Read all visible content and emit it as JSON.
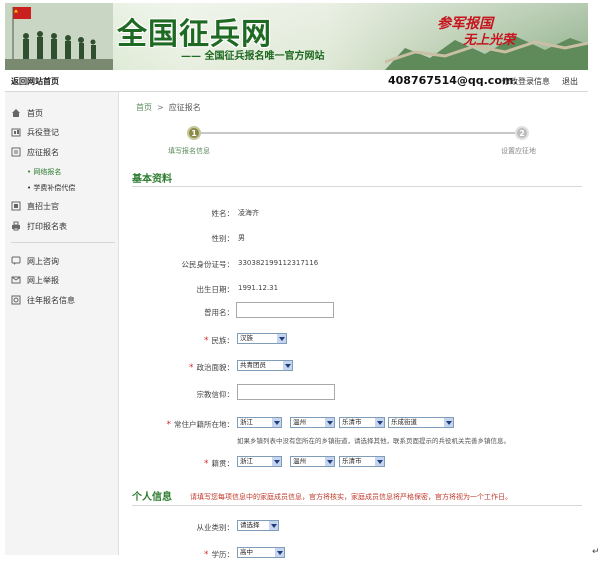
{
  "banner": {
    "brand": "全国征兵网",
    "slogan": "—— 全国征兵报名唯一官方网站",
    "motto_line1": "参军报国",
    "motto_line2": "无上光荣"
  },
  "topbar": {
    "home": "返回网站首页",
    "email": "408767514@qq.com.",
    "edit_info": "修改登录信息",
    "logout": "退出"
  },
  "sidebar": {
    "items": [
      {
        "label": "首页",
        "icon": "home-icon"
      },
      {
        "label": "兵役登记",
        "icon": "register-icon"
      },
      {
        "label": "应征报名",
        "icon": "apply-icon"
      },
      {
        "label": "直招士官",
        "icon": "sergeant-icon"
      },
      {
        "label": "打印报名表",
        "icon": "print-icon"
      },
      {
        "label": "网上咨询",
        "icon": "consult-icon"
      },
      {
        "label": "网上举报",
        "icon": "report-icon"
      },
      {
        "label": "往年报名信息",
        "icon": "history-icon"
      }
    ],
    "sub_items": [
      {
        "label": "• 网络报名",
        "active": true
      },
      {
        "label": "• 学费补偿代偿",
        "active": false
      }
    ]
  },
  "breadcrumb": {
    "home": "首页",
    "separator": ">",
    "current": "应征报名"
  },
  "steps": [
    {
      "number": "1",
      "label": "填写报名信息"
    },
    {
      "number": "2",
      "label": "设置应征地"
    }
  ],
  "basic": {
    "title": "基本资料",
    "name_label": "姓名：",
    "name_value": "凌海齐",
    "gender_label": "性别：",
    "gender_value": "男",
    "id_label": "公民身份证号：",
    "id_value": "330382199112317116",
    "birth_label": "出生日期：",
    "birth_value": "1991.12.31",
    "former_name_label": "曾用名：",
    "ethnic_label": "民族：",
    "ethnic_value": "汉族",
    "political_label": "政治面貌：",
    "political_value": "共青团员",
    "religion_label": "宗教信仰：",
    "residence_label": "常住户籍所在地：",
    "residence_values": [
      "浙江",
      "温州",
      "乐清市",
      "乐成街道"
    ],
    "residence_hint": "如果乡镇列表中没有您所在的乡镇街道，请选择其他，联系页面提示的兵役机关完善乡镇信息。",
    "native_label": "籍贯：",
    "native_values": [
      "浙江",
      "温州",
      "乐清市"
    ]
  },
  "personal": {
    "title": "个人信息",
    "note": "请填写您每项信息中的家庭成员信息，官方将核实，家庭成员信息将严格保密，官方将视为一个工作日。",
    "job_label": "从业类别：",
    "job_value": "请选择",
    "last_label": "学历：",
    "last_value": "高中"
  },
  "colors": {
    "accent": "#2e7d32",
    "required": "#d32f2f"
  }
}
